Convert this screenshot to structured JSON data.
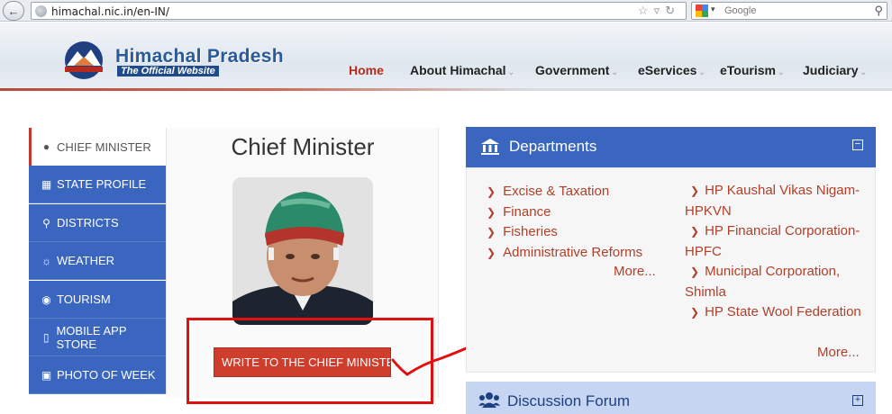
{
  "browser": {
    "url": "himachal.nic.in/en-IN/",
    "search_placeholder": "Google"
  },
  "site": {
    "title": "Himachal Pradesh",
    "subtitle": "The Official Website",
    "nav": [
      "Home",
      "About Himachal",
      "Government",
      "eServices",
      "eTourism",
      "Judiciary"
    ]
  },
  "sidebar": {
    "items": [
      {
        "label": "CHIEF MINISTER",
        "icon": "user-icon"
      },
      {
        "label": "STATE PROFILE",
        "icon": "area-chart-icon"
      },
      {
        "label": "DISTRICTS",
        "icon": "map-marker-icon"
      },
      {
        "label": "WEATHER",
        "icon": "sun-icon"
      },
      {
        "label": "TOURISM",
        "icon": "camera-icon"
      },
      {
        "label": "MOBILE APP STORE",
        "icon": "mobile-icon"
      },
      {
        "label": "PHOTO OF WEEK",
        "icon": "picture-icon"
      }
    ]
  },
  "cm": {
    "title": "Chief Minister",
    "write_button": "WRITE TO THE CHIEF MINISTER"
  },
  "departments": {
    "title": "Departments",
    "left": [
      "Excise & Taxation",
      "Finance",
      "Fisheries",
      "Administrative Reforms"
    ],
    "more_left": "More...",
    "right": [
      "HP Kaushal Vikas Nigam-HPKVN",
      "HP Financial Corporation-HPFC",
      "Municipal Corporation, Shimla",
      "HP State Wool Federation"
    ],
    "more_right": "More..."
  },
  "forum": {
    "title": "Discussion Forum"
  },
  "colors": {
    "primary_blue": "#3a66bf",
    "link_red": "#b0402a",
    "button_red": "#cf3e2d",
    "annotation_red": "#e01010"
  }
}
